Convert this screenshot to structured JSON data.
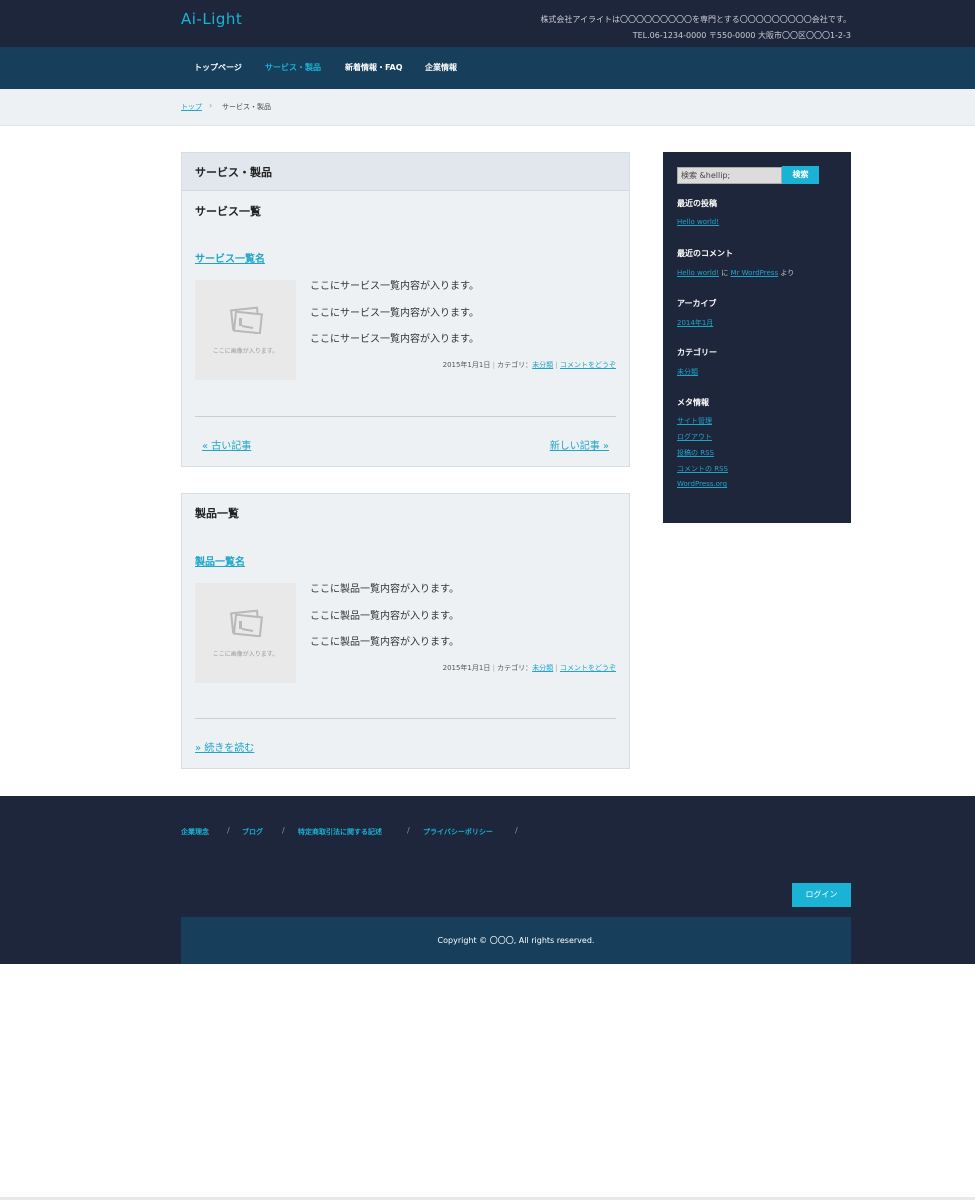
{
  "header": {
    "logo": "Ai-Light",
    "tagline_line1": "株式会社アイライトは〇〇〇〇〇〇〇〇〇を専門とする〇〇〇〇〇〇〇〇〇会社です。",
    "tagline_line2": "TEL.06-1234-0000 〒550-0000 大阪市〇〇区〇〇〇1-2-3"
  },
  "nav": {
    "items": [
      {
        "label": "トップページ"
      },
      {
        "label": "サービス・製品"
      },
      {
        "label": "新着情報・FAQ"
      },
      {
        "label": "企業情報"
      }
    ],
    "active_index": 1
  },
  "breadcrumb": {
    "home": "トップ",
    "separator": "›",
    "current": "サービス・製品"
  },
  "main": {
    "page_title": "サービス・製品",
    "services": {
      "section_title": "サービス一覧",
      "post_title": "サービス一覧名",
      "thumb_text": "ここに画像が入ります。",
      "excerpt": [
        "ここにサービス一覧内容が入ります。",
        "ここにサービス一覧内容が入ります。",
        "ここにサービス一覧内容が入ります。"
      ],
      "meta_date": "2015年1月1日",
      "meta_category_label": "カテゴリ：",
      "meta_category": "未分類",
      "meta_comment": "コメントをどうぞ",
      "older": "« 古い記事",
      "newer": "新しい記事 »"
    },
    "products": {
      "section_title": "製品一覧",
      "post_title": "製品一覧名",
      "thumb_text": "ここに画像が入ります。",
      "excerpt": [
        "ここに製品一覧内容が入ります。",
        "ここに製品一覧内容が入ります。",
        "ここに製品一覧内容が入ります。"
      ],
      "meta_date": "2015年1月1日",
      "meta_category_label": "カテゴリ：",
      "meta_category": "未分類",
      "meta_comment": "コメントをどうぞ",
      "read_more": "» 続きを読む"
    }
  },
  "sidebar": {
    "search_value": "検索 &hellip;",
    "search_button": "検索",
    "recent_posts_title": "最近の投稿",
    "recent_post": "Hello world!",
    "recent_comments_title": "最近のコメント",
    "comment_post": "Hello world!",
    "comment_on": "に",
    "comment_author": "Mr WordPress",
    "comment_from": "より",
    "archives_title": "アーカイブ",
    "archive": "2014年1月",
    "categories_title": "カテゴリー",
    "category": "未分類",
    "meta_title": "メタ情報",
    "meta_links": [
      "サイト管理",
      "ログアウト",
      "投稿の RSS",
      "コメントの RSS",
      "WordPress.org"
    ]
  },
  "footer": {
    "links": [
      "企業理念",
      "ブログ",
      "特定商取引法に関する記述",
      "プライバシーポリシー"
    ],
    "separator": "/",
    "login": "ログイン",
    "copyright": "Copyright © 〇〇〇, All rights reserved."
  },
  "colors": {
    "dark_navy": "#1e263b",
    "nav_blue": "#173f5c",
    "accent": "#1ab3d6"
  }
}
